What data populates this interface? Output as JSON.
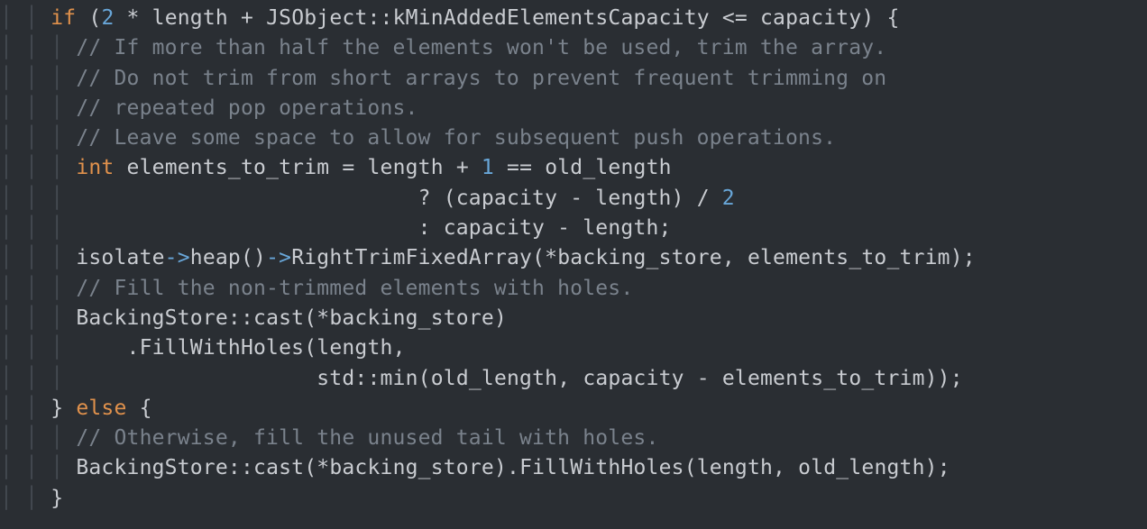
{
  "theme": {
    "background": "#2a2e33",
    "default_text": "#c9ccd1",
    "keyword": "#e0914c",
    "number": "#68a6d8",
    "comment": "#7a828c",
    "indent_guide": "rgba(120,130,140,0.35)"
  },
  "code": {
    "indent_unit": "  ",
    "lines": [
      {
        "indent": 2,
        "tokens": [
          {
            "t": "kw",
            "v": "if"
          },
          {
            "t": "pn",
            "v": " ("
          },
          {
            "t": "num",
            "v": "2"
          },
          {
            "t": "pn",
            "v": " * "
          },
          {
            "t": "id",
            "v": "length"
          },
          {
            "t": "pn",
            "v": " + "
          },
          {
            "t": "id",
            "v": "JSObject"
          },
          {
            "t": "pn",
            "v": "::"
          },
          {
            "t": "id",
            "v": "kMinAddedElementsCapacity"
          },
          {
            "t": "pn",
            "v": " <= "
          },
          {
            "t": "id",
            "v": "capacity"
          },
          {
            "t": "pn",
            "v": ") {"
          }
        ]
      },
      {
        "indent": 3,
        "tokens": [
          {
            "t": "cm",
            "v": "// If more than half the elements won't be used, trim the array."
          }
        ]
      },
      {
        "indent": 3,
        "tokens": [
          {
            "t": "cm",
            "v": "// Do not trim from short arrays to prevent frequent trimming on"
          }
        ]
      },
      {
        "indent": 3,
        "tokens": [
          {
            "t": "cm",
            "v": "// repeated pop operations."
          }
        ]
      },
      {
        "indent": 3,
        "tokens": [
          {
            "t": "cm",
            "v": "// Leave some space to allow for subsequent push operations."
          }
        ]
      },
      {
        "indent": 3,
        "tokens": [
          {
            "t": "kw",
            "v": "int"
          },
          {
            "t": "pn",
            "v": " "
          },
          {
            "t": "id",
            "v": "elements_to_trim"
          },
          {
            "t": "pn",
            "v": " = "
          },
          {
            "t": "id",
            "v": "length"
          },
          {
            "t": "pn",
            "v": " + "
          },
          {
            "t": "num",
            "v": "1"
          },
          {
            "t": "pn",
            "v": " == "
          },
          {
            "t": "id",
            "v": "old_length"
          }
        ]
      },
      {
        "indent": 3,
        "tokens": [
          {
            "t": "pn",
            "v": "                           ? ("
          },
          {
            "t": "id",
            "v": "capacity"
          },
          {
            "t": "pn",
            "v": " - "
          },
          {
            "t": "id",
            "v": "length"
          },
          {
            "t": "pn",
            "v": ") / "
          },
          {
            "t": "num",
            "v": "2"
          }
        ]
      },
      {
        "indent": 3,
        "tokens": [
          {
            "t": "pn",
            "v": "                           : "
          },
          {
            "t": "id",
            "v": "capacity"
          },
          {
            "t": "pn",
            "v": " - "
          },
          {
            "t": "id",
            "v": "length"
          },
          {
            "t": "pn",
            "v": ";"
          }
        ]
      },
      {
        "indent": 3,
        "tokens": [
          {
            "t": "id",
            "v": "isolate"
          },
          {
            "t": "op",
            "v": "->"
          },
          {
            "t": "fn",
            "v": "heap"
          },
          {
            "t": "pn",
            "v": "()"
          },
          {
            "t": "op",
            "v": "->"
          },
          {
            "t": "fn",
            "v": "RightTrimFixedArray"
          },
          {
            "t": "pn",
            "v": "(*"
          },
          {
            "t": "id",
            "v": "backing_store"
          },
          {
            "t": "pn",
            "v": ", "
          },
          {
            "t": "id",
            "v": "elements_to_trim"
          },
          {
            "t": "pn",
            "v": ");"
          }
        ]
      },
      {
        "indent": 3,
        "tokens": [
          {
            "t": "cm",
            "v": "// Fill the non-trimmed elements with holes."
          }
        ]
      },
      {
        "indent": 3,
        "tokens": [
          {
            "t": "id",
            "v": "BackingStore"
          },
          {
            "t": "pn",
            "v": "::"
          },
          {
            "t": "fn",
            "v": "cast"
          },
          {
            "t": "pn",
            "v": "(*"
          },
          {
            "t": "id",
            "v": "backing_store"
          },
          {
            "t": "pn",
            "v": ")"
          }
        ]
      },
      {
        "indent": 3,
        "tokens": [
          {
            "t": "pn",
            "v": "    ."
          },
          {
            "t": "fn",
            "v": "FillWithHoles"
          },
          {
            "t": "pn",
            "v": "("
          },
          {
            "t": "id",
            "v": "length"
          },
          {
            "t": "pn",
            "v": ","
          }
        ]
      },
      {
        "indent": 3,
        "tokens": [
          {
            "t": "pn",
            "v": "                   "
          },
          {
            "t": "id",
            "v": "std"
          },
          {
            "t": "pn",
            "v": "::"
          },
          {
            "t": "fn",
            "v": "min"
          },
          {
            "t": "pn",
            "v": "("
          },
          {
            "t": "id",
            "v": "old_length"
          },
          {
            "t": "pn",
            "v": ", "
          },
          {
            "t": "id",
            "v": "capacity"
          },
          {
            "t": "pn",
            "v": " - "
          },
          {
            "t": "id",
            "v": "elements_to_trim"
          },
          {
            "t": "pn",
            "v": "));"
          }
        ]
      },
      {
        "indent": 2,
        "tokens": [
          {
            "t": "pn",
            "v": "} "
          },
          {
            "t": "kw",
            "v": "else"
          },
          {
            "t": "pn",
            "v": " {"
          }
        ]
      },
      {
        "indent": 3,
        "tokens": [
          {
            "t": "cm",
            "v": "// Otherwise, fill the unused tail with holes."
          }
        ]
      },
      {
        "indent": 3,
        "tokens": [
          {
            "t": "id",
            "v": "BackingStore"
          },
          {
            "t": "pn",
            "v": "::"
          },
          {
            "t": "fn",
            "v": "cast"
          },
          {
            "t": "pn",
            "v": "(*"
          },
          {
            "t": "id",
            "v": "backing_store"
          },
          {
            "t": "pn",
            "v": ")."
          },
          {
            "t": "fn",
            "v": "FillWithHoles"
          },
          {
            "t": "pn",
            "v": "("
          },
          {
            "t": "id",
            "v": "length"
          },
          {
            "t": "pn",
            "v": ", "
          },
          {
            "t": "id",
            "v": "old_length"
          },
          {
            "t": "pn",
            "v": ");"
          }
        ]
      },
      {
        "indent": 2,
        "tokens": [
          {
            "t": "pn",
            "v": "}"
          }
        ]
      }
    ]
  }
}
